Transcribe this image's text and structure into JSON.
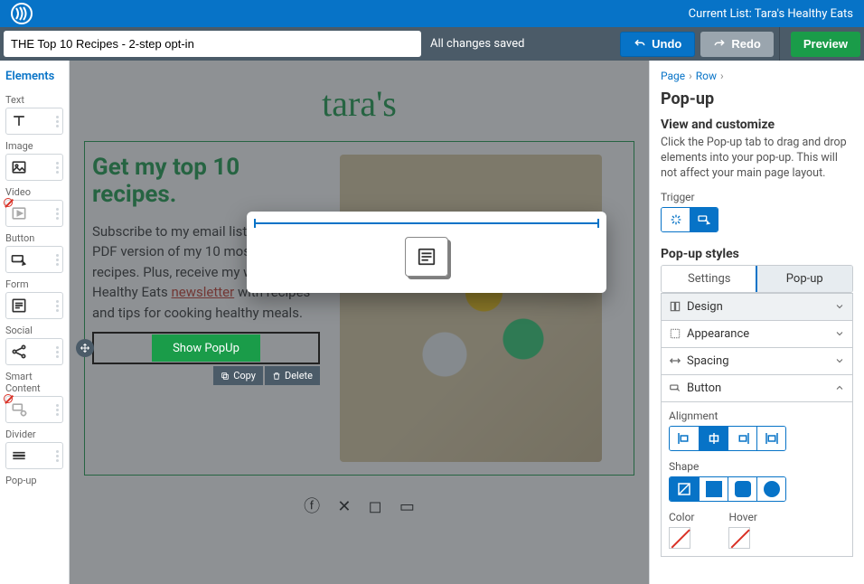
{
  "header": {
    "current_list": "Current List: Tara's Healthy Eats"
  },
  "toolbar": {
    "title": "THE Top 10 Recipes - 2-step opt-in",
    "save_status": "All changes saved",
    "undo": "Undo",
    "redo": "Redo",
    "preview": "Preview"
  },
  "sidebar": {
    "title": "Elements",
    "items": [
      {
        "label": "Text"
      },
      {
        "label": "Image"
      },
      {
        "label": "Video"
      },
      {
        "label": "Button"
      },
      {
        "label": "Form"
      },
      {
        "label": "Social"
      },
      {
        "label": "Smart Content"
      },
      {
        "label": "Divider"
      },
      {
        "label": "Pop-up"
      }
    ]
  },
  "canvas": {
    "brand": "tara's",
    "headline": "Get my top 10 recipes.",
    "body_pre": "Subscribe to my email list to receive a PDF version of my 10 most-requested recipes. Plus, receive my weekly Healthy Eats ",
    "body_link": "newsletter",
    "body_post": " with recipes and tips for cooking healthy meals.",
    "button_label": "Show PopUp",
    "copy": "Copy",
    "delete": "Delete"
  },
  "inspector": {
    "breadcrumb": [
      "Page",
      "Row"
    ],
    "title": "Pop-up",
    "subheading": "View and customize",
    "help": "Click the Pop-up tab to drag and drop elements into your pop-up. This will not affect your main page layout.",
    "trigger_label": "Trigger",
    "styles_title": "Pop-up styles",
    "tabs": {
      "settings": "Settings",
      "popup": "Pop-up"
    },
    "sections": {
      "design": "Design",
      "appearance": "Appearance",
      "spacing": "Spacing",
      "button": "Button"
    },
    "button_section": {
      "alignment": "Alignment",
      "shape": "Shape",
      "color": "Color",
      "hover": "Hover"
    }
  }
}
